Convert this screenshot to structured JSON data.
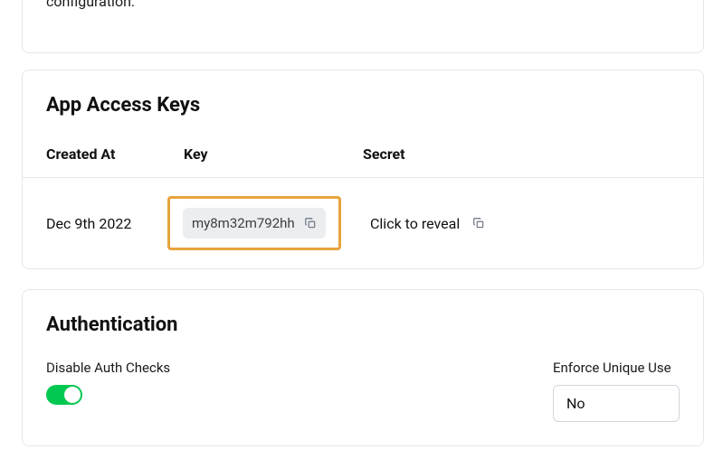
{
  "top_card": {
    "text_tail": "configuration."
  },
  "access_keys": {
    "title": "App Access Keys",
    "columns": {
      "created_at": "Created At",
      "key": "Key",
      "secret": "Secret"
    },
    "row": {
      "created_at": "Dec 9th 2022",
      "key_value": "my8m32m792hh",
      "secret_label": "Click to reveal"
    }
  },
  "authentication": {
    "title": "Authentication",
    "disable_auth_label": "Disable Auth Checks",
    "disable_auth_on": true,
    "enforce_unique_label": "Enforce Unique Use",
    "enforce_unique_value": "No"
  }
}
